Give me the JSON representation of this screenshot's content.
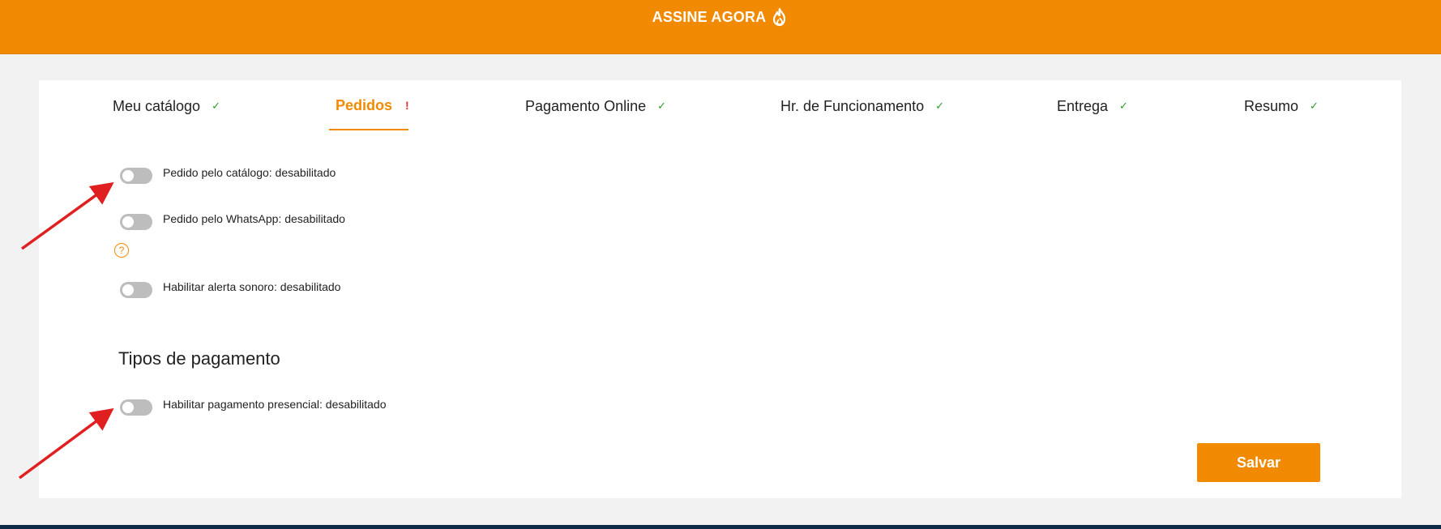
{
  "banner": {
    "cta_label": "ASSINE AGORA",
    "icon": "flame-icon",
    "background_color": "#f28a00"
  },
  "tabs": [
    {
      "label": "Meu catálogo",
      "status": "✓",
      "active": false
    },
    {
      "label": "Pedidos",
      "status": "!",
      "active": true
    },
    {
      "label": "Pagamento Online",
      "status": "✓",
      "active": false
    },
    {
      "label": "Hr. de Funcionamento",
      "status": "✓",
      "active": false
    },
    {
      "label": "Entrega",
      "status": "✓",
      "active": false
    },
    {
      "label": "Resumo",
      "status": "✓",
      "active": false
    }
  ],
  "settings": [
    {
      "label": "Pedido pelo catálogo: desabilitado",
      "enabled": false
    },
    {
      "label": "Pedido pelo WhatsApp: desabilitado",
      "enabled": false
    },
    {
      "label": "Habilitar alerta sonoro: desabilitado",
      "enabled": false
    }
  ],
  "help_icon": {
    "glyph": "?"
  },
  "payment_section": {
    "title": "Tipos de pagamento",
    "settings": [
      {
        "label": "Habilitar pagamento presencial: desabilitado",
        "enabled": false
      }
    ]
  },
  "actions": {
    "save_label": "Salvar"
  },
  "colors": {
    "accent": "#f28a00",
    "check": "#2a9d2a",
    "alert": "#e03030",
    "toggle_off": "#bdbdbd",
    "annotation_arrow": "#e02020",
    "footer": "#0d2a47"
  }
}
